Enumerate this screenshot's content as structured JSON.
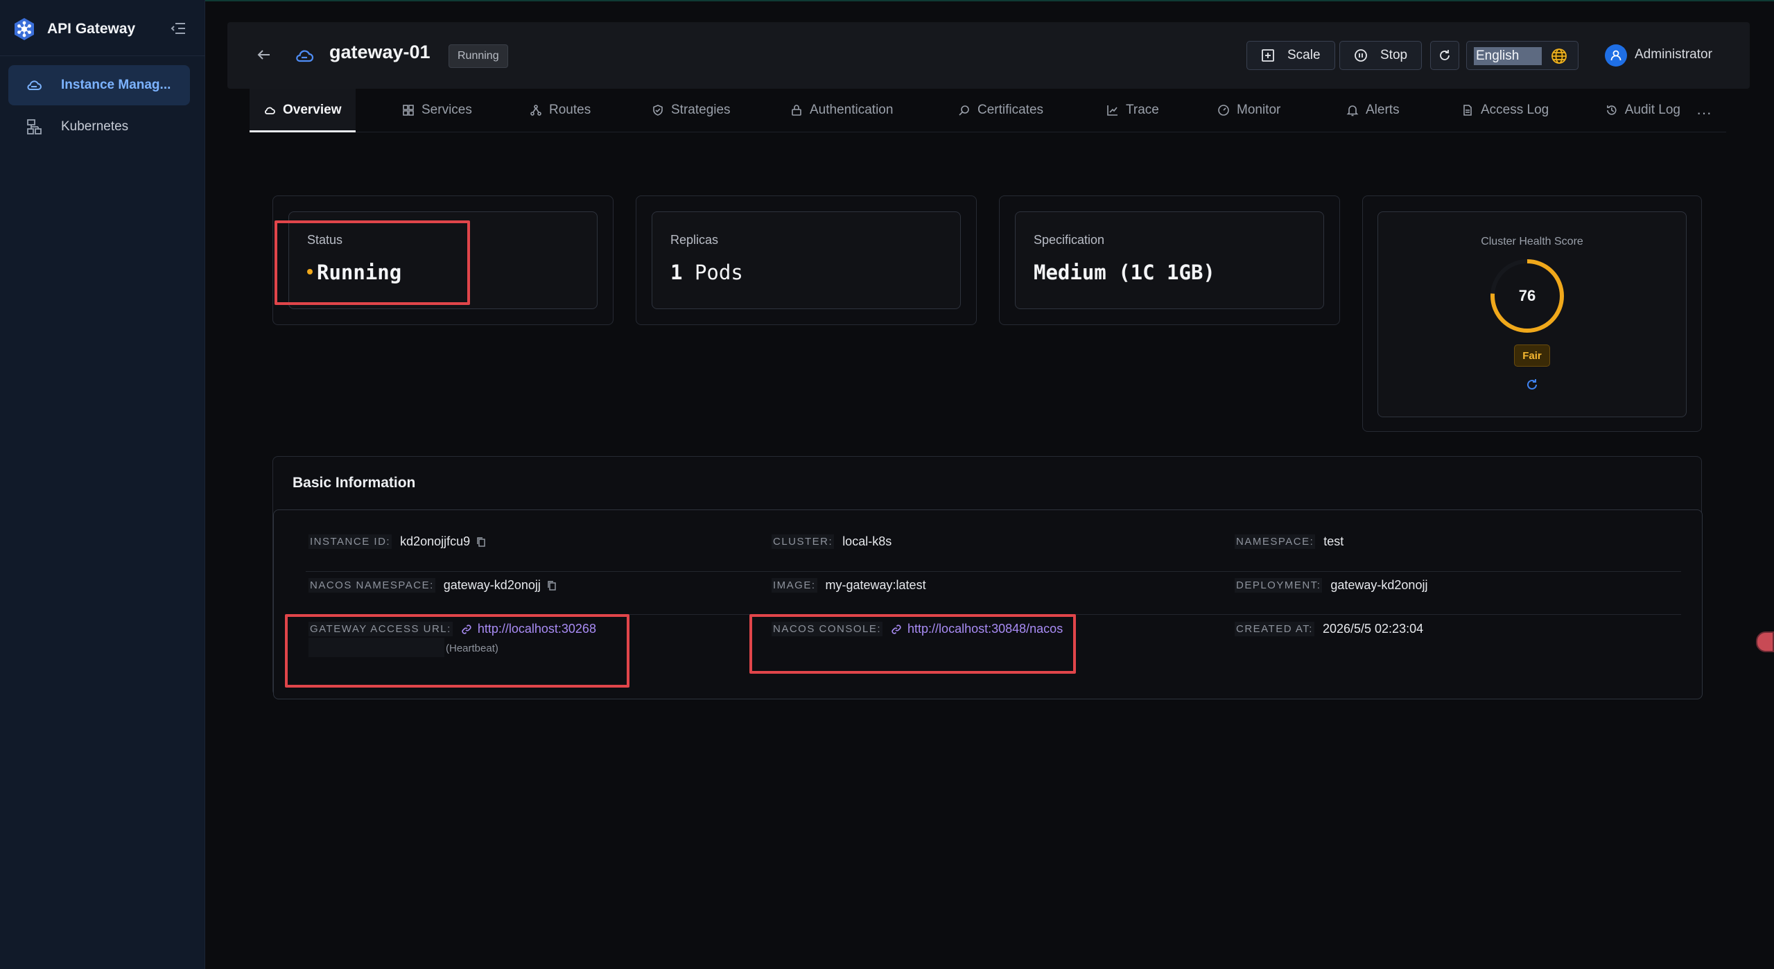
{
  "sidebar": {
    "brand_title": "API Gateway",
    "items": [
      {
        "label": "Instance Manag...",
        "icon": "cloud-icon",
        "active": true
      },
      {
        "label": "Kubernetes",
        "icon": "cluster-icon",
        "active": false
      }
    ]
  },
  "header": {
    "instance_name": "gateway-01",
    "status_badge": "Running",
    "buttons": {
      "scale": "Scale",
      "stop": "Stop"
    },
    "language": "English",
    "user": "Administrator"
  },
  "tabs": [
    "Overview",
    "Services",
    "Routes",
    "Strategies",
    "Authentication",
    "Certificates",
    "Trace",
    "Monitor",
    "Alerts",
    "Access Log",
    "Audit Log"
  ],
  "tabs_more": "···",
  "cards": {
    "status": {
      "label": "Status",
      "value": "Running"
    },
    "replicas": {
      "label": "Replicas",
      "value": "1",
      "unit": "Pods"
    },
    "spec": {
      "label": "Specification",
      "value": "Medium (1C 1GB)"
    },
    "health": {
      "title": "Cluster Health Score",
      "score": "76",
      "score_fraction": 0.76,
      "rating": "Fair"
    }
  },
  "basic_info": {
    "title": "Basic Information",
    "instance_id": {
      "label": "INSTANCE ID:",
      "value": "kd2onojjfcu9"
    },
    "cluster": {
      "label": "CLUSTER:",
      "value": "local-k8s"
    },
    "namespace": {
      "label": "NAMESPACE:",
      "value": "test"
    },
    "nacos_namespace": {
      "label": "NACOS NAMESPACE:",
      "value": "gateway-kd2onojj"
    },
    "image": {
      "label": "IMAGE:",
      "value": "my-gateway:latest"
    },
    "deployment": {
      "label": "DEPLOYMENT:",
      "value": "gateway-kd2onojj"
    },
    "gateway_url": {
      "label": "GATEWAY ACCESS URL:",
      "value": "http://localhost:30268",
      "note": "(Heartbeat)"
    },
    "nacos_console": {
      "label": "NACOS CONSOLE:",
      "value": "http://localhost:30848/nacos"
    },
    "created_at": {
      "label": "CREATED AT:",
      "value": "2026/5/5 02:23:04"
    }
  },
  "colors": {
    "accent": "#7cb3ff",
    "running": "#f0a81b",
    "link": "#a98cf5",
    "highlight": "#e0454a"
  }
}
